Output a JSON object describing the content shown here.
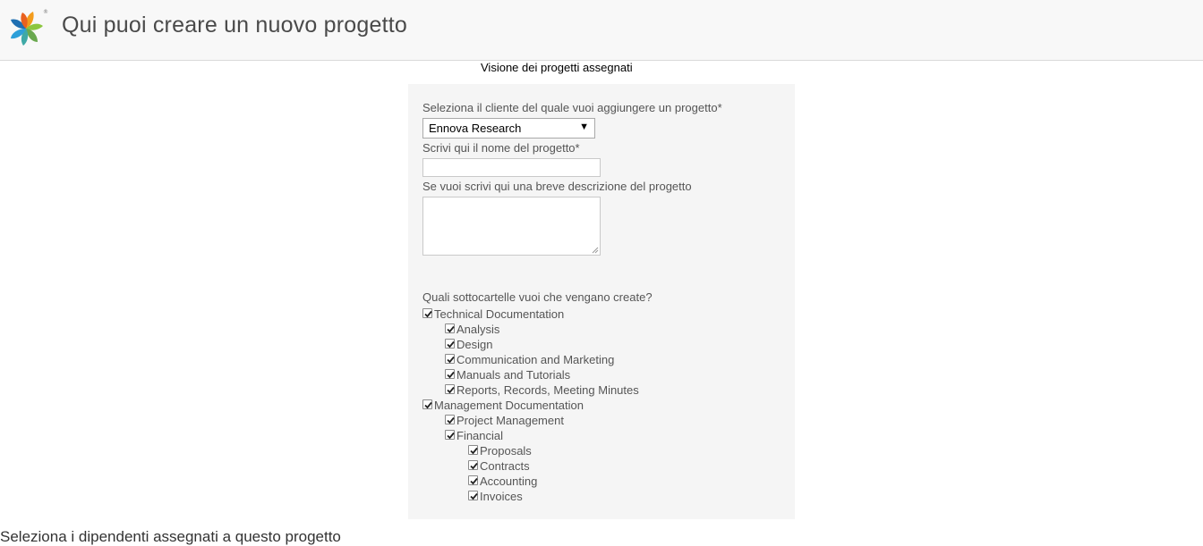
{
  "header": {
    "title": "Qui puoi creare un nuovo progetto",
    "logo_icon": "alfresco-flower-logo-icon"
  },
  "nav": {
    "assigned_projects_link": "Visione dei progetti assegnati"
  },
  "form": {
    "client_label": "Seleziona il cliente del quale vuoi aggiungere un progetto*",
    "client_selected": "Ennova Research",
    "project_name_label": "Scrivi qui il nome del progetto*",
    "project_name_value": "",
    "description_label": "Se vuoi scrivi qui una breve descrizione del progetto",
    "description_value": "",
    "subfolders_label": "Quali sottocartelle vuoi che vengano create?",
    "subfolders": [
      {
        "label": "Technical Documentation",
        "checked": true,
        "level": 0
      },
      {
        "label": "Analysis",
        "checked": true,
        "level": 1
      },
      {
        "label": "Design",
        "checked": true,
        "level": 1
      },
      {
        "label": "Communication and Marketing",
        "checked": true,
        "level": 1
      },
      {
        "label": "Manuals and Tutorials",
        "checked": true,
        "level": 1
      },
      {
        "label": "Reports, Records, Meeting Minutes",
        "checked": true,
        "level": 1
      },
      {
        "label": "Management Documentation",
        "checked": true,
        "level": 0
      },
      {
        "label": "Project Management",
        "checked": true,
        "level": 1
      },
      {
        "label": "Financial",
        "checked": true,
        "level": 1
      },
      {
        "label": "Proposals",
        "checked": true,
        "level": 2
      },
      {
        "label": "Contracts",
        "checked": true,
        "level": 2
      },
      {
        "label": "Accounting",
        "checked": true,
        "level": 2
      },
      {
        "label": "Invoices",
        "checked": true,
        "level": 2
      }
    ]
  },
  "employees": {
    "heading": "Seleziona i dipendenti assegnati a questo progetto"
  },
  "colors": {
    "header_bg": "#f8f8f8",
    "panel_bg": "#f5f5f5"
  }
}
